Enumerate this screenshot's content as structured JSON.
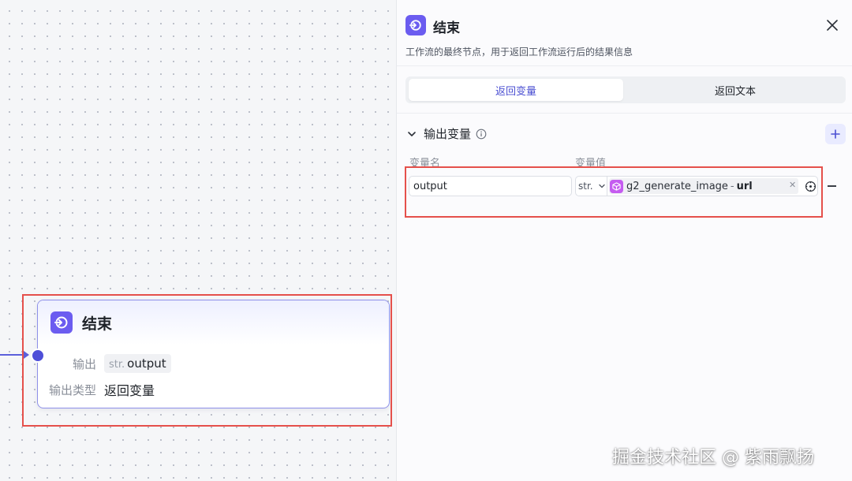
{
  "canvas_node": {
    "title": "结束",
    "output_label": "输出",
    "output_type_tag": "str.",
    "output_var": "output",
    "output_kind_label": "输出类型",
    "output_kind_value": "返回变量"
  },
  "panel": {
    "title": "结束",
    "description": "工作流的最终节点，用于返回工作流运行后的结果信息",
    "tabs": [
      {
        "label": "返回变量",
        "active": true
      },
      {
        "label": "返回文本",
        "active": false
      }
    ],
    "section_title": "输出变量",
    "columns": {
      "name": "变量名",
      "value": "变量值"
    },
    "row": {
      "name_value": "output",
      "type": "str.",
      "ref_node": "g2_generate_image",
      "ref_separator": "-",
      "ref_field": "url"
    }
  },
  "watermark": "掘金技术社区 @ 紫雨飘扬",
  "colors": {
    "accent": "#6b5cf0",
    "highlight_border": "#e5504b",
    "tab_active_text": "#4b4fd2",
    "ref_node_icon": "#c55cf0"
  },
  "icons": [
    "end-node-icon",
    "close-icon",
    "chevron-down-icon",
    "info-icon",
    "plus-icon",
    "cube-icon",
    "clear-icon",
    "variable-ref-icon",
    "minus-icon"
  ]
}
